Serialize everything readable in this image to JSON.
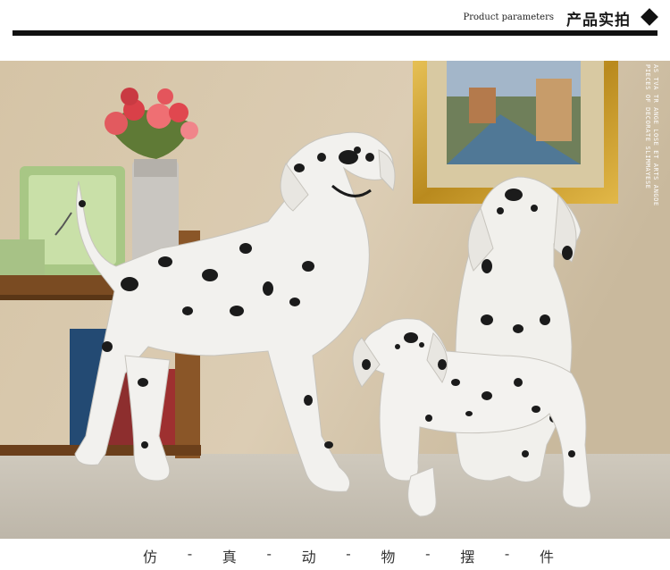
{
  "header": {
    "title": "产品实拍",
    "subtitle": "Product parameters"
  },
  "side_caption": "AS TVA TR ANGE LOSE ET ARTS ANGDE PIECES OF DECORATE SLIMMAYESE",
  "footer": {
    "chars": [
      "仿",
      "-",
      "真",
      "-",
      "动",
      "-",
      "物",
      "-",
      "摆",
      "-",
      "件"
    ]
  },
  "colors": {
    "wall": "#d8c8ad",
    "floor": "#c9c2b5",
    "frame_gold": "#c99a2a",
    "dog_white": "#f2f1ee",
    "dog_spot": "#1b1b1b"
  }
}
